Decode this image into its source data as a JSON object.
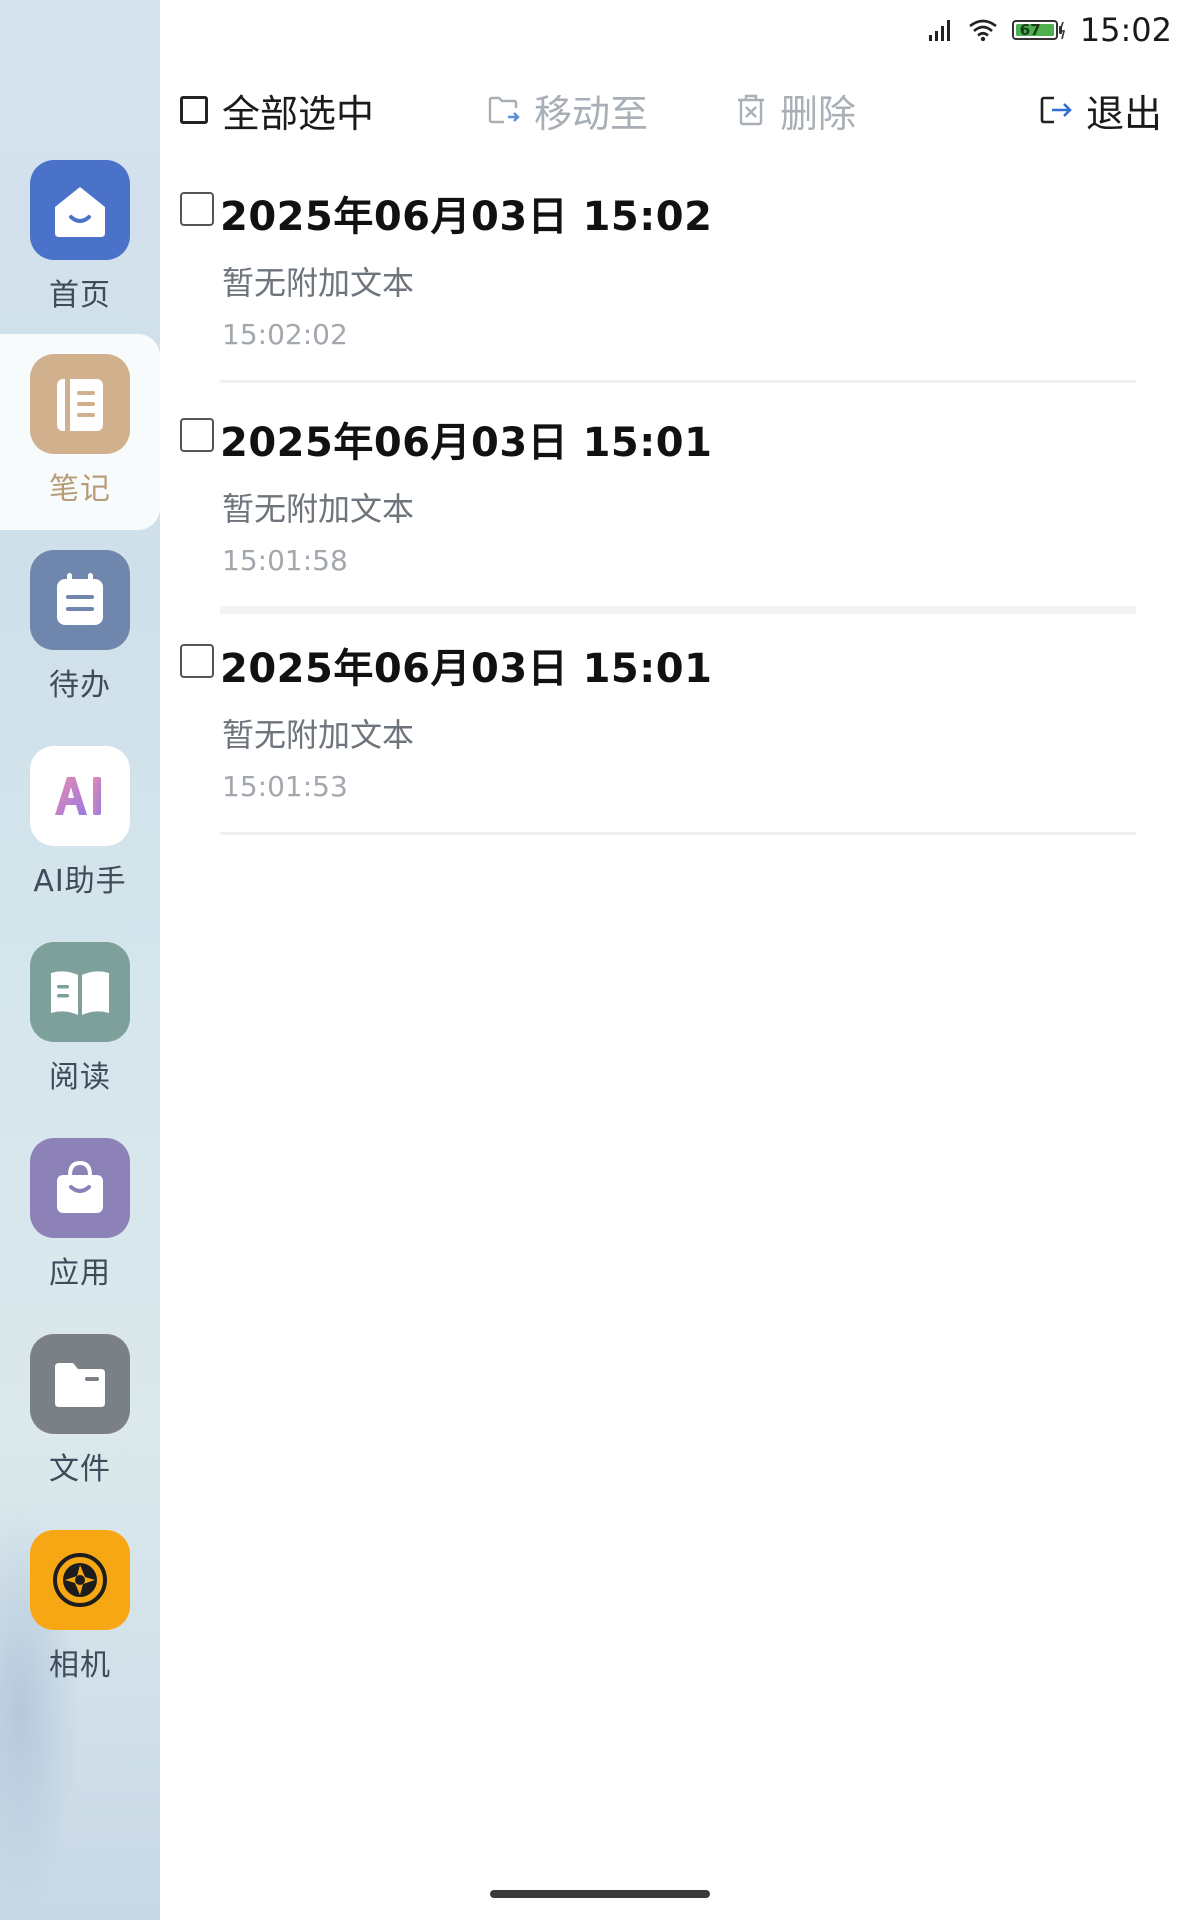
{
  "status_bar": {
    "time": "15:02",
    "battery": "67"
  },
  "toolbar": {
    "select_all": "全部选中",
    "move_to": "移动至",
    "delete": "删除",
    "exit": "退出"
  },
  "sidebar": {
    "items": [
      {
        "label": "首页",
        "icon": "home-icon",
        "color": "#4a72c8"
      },
      {
        "label": "笔记",
        "icon": "notebook-icon",
        "color": "#d1b08e"
      },
      {
        "label": "待办",
        "icon": "calendar-todo-icon",
        "color": "#6f86ad"
      },
      {
        "label": "AI助手",
        "icon": "ai-assistant-icon",
        "color": "#ffffff"
      },
      {
        "label": "阅读",
        "icon": "book-icon",
        "color": "#7ea09a"
      },
      {
        "label": "应用",
        "icon": "shopping-bag-icon",
        "color": "#8d82b8"
      },
      {
        "label": "文件",
        "icon": "folder-icon",
        "color": "#7b7f86"
      },
      {
        "label": "相机",
        "icon": "camera-icon",
        "color": "#f6a713"
      }
    ],
    "active_index": 1
  },
  "notes": [
    {
      "title": "2025年06月03日 15:02",
      "subtitle": "暂无附加文本",
      "time": "15:02:02"
    },
    {
      "title": "2025年06月03日 15:01",
      "subtitle": "暂无附加文本",
      "time": "15:01:58"
    },
    {
      "title": "2025年06月03日 15:01",
      "subtitle": "暂无附加文本",
      "time": "15:01:53"
    }
  ]
}
